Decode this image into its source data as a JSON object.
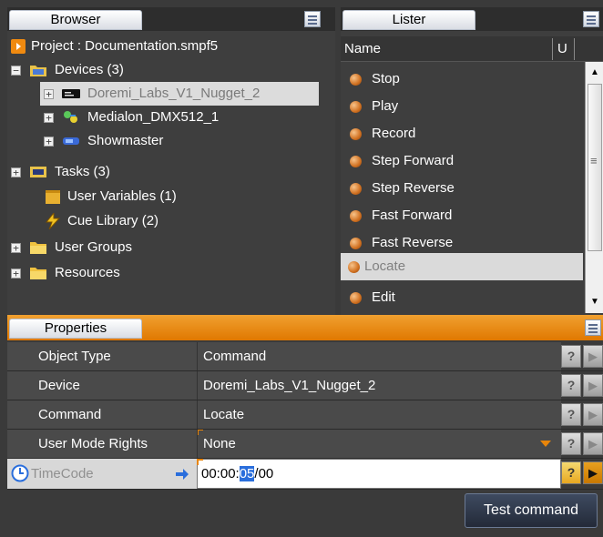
{
  "browser": {
    "tab_label": "Browser",
    "project_label": "Project : Documentation.smpf5",
    "items": [
      {
        "label": "Devices (3)",
        "expander": "−"
      },
      {
        "label": "Doremi_Labs_V1_Nugget_2",
        "expander": "+"
      },
      {
        "label": "Medialon_DMX512_1",
        "expander": "+"
      },
      {
        "label": "Showmaster",
        "expander": "+"
      },
      {
        "label": "Tasks (3)",
        "expander": "+"
      },
      {
        "label": "User Variables (1)"
      },
      {
        "label": "Cue Library (2)"
      },
      {
        "label": "User Groups",
        "expander": "+"
      },
      {
        "label": "Resources",
        "expander": "+"
      }
    ]
  },
  "lister": {
    "tab_label": "Lister",
    "columns": [
      "Name",
      "U"
    ],
    "items": [
      "Stop",
      "Play",
      "Record",
      "Step Forward",
      "Step Reverse",
      "Fast Forward",
      "Fast Reverse",
      "Locate",
      "Edit"
    ],
    "selected_item": "Locate",
    "scroll_mark": "≡"
  },
  "properties": {
    "tab_label": "Properties",
    "rows": [
      {
        "name": "Object Type",
        "value": "Command"
      },
      {
        "name": "Device",
        "value": "Doremi_Labs_V1_Nugget_2"
      },
      {
        "name": "Command",
        "value": "Locate"
      },
      {
        "name": "User Mode Rights",
        "value": "None"
      }
    ],
    "timecode": {
      "name": "TimeCode",
      "value_before": "00:00:",
      "value_selected": "05",
      "value_after": "/00"
    },
    "help_glyph": "?",
    "play_glyph": "▶",
    "test_button_label": "Test command"
  },
  "colors": {
    "accent_orange": "#e8850a",
    "selection_blue": "#2a6edc"
  }
}
